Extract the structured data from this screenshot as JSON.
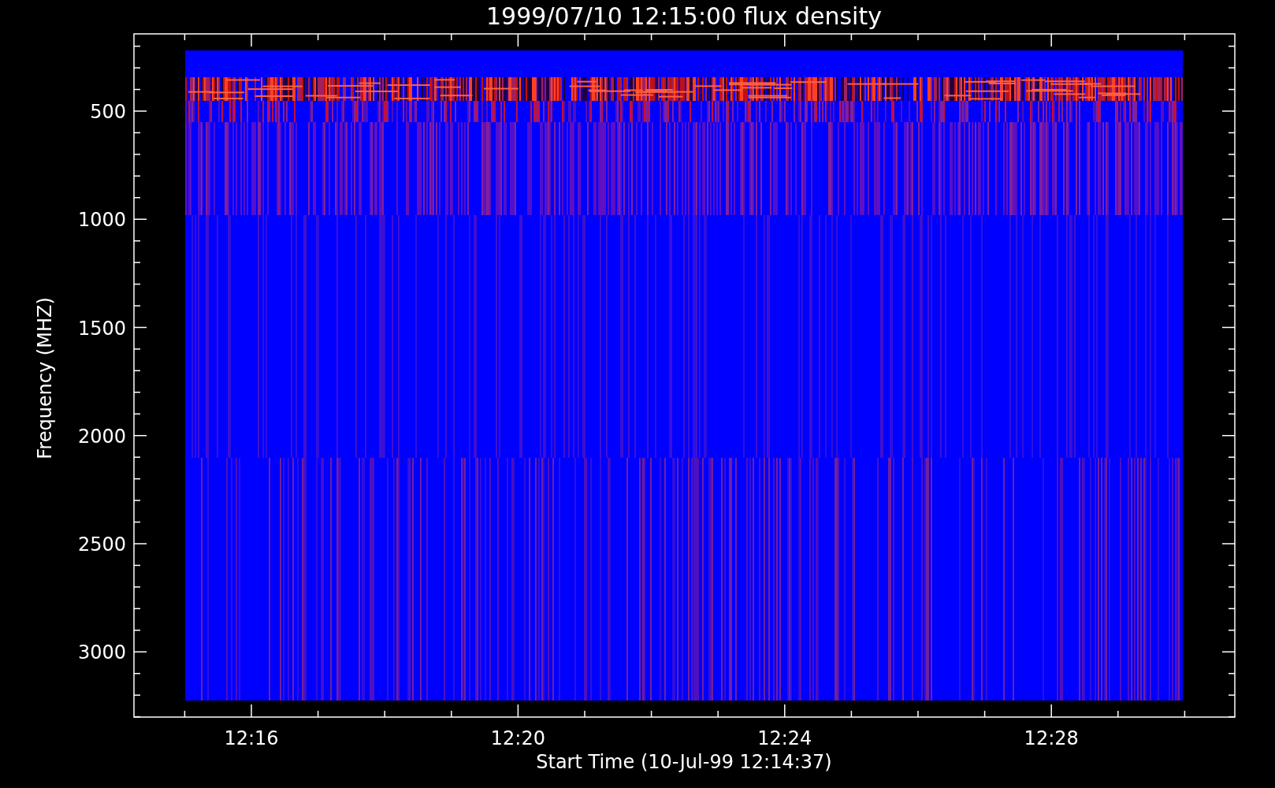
{
  "plot": {
    "title": "1999/07/10 12:15:00 flux density",
    "ylabel": "Frequency (MHZ)",
    "xlabel": "Start Time (10-Jul-99 12:14:37)",
    "yticks": [
      {
        "label": "500"
      },
      {
        "label": "1000"
      },
      {
        "label": "1500"
      },
      {
        "label": "2000"
      },
      {
        "label": "2500"
      },
      {
        "label": "3000"
      }
    ],
    "xticks": [
      {
        "label": "12:16"
      },
      {
        "label": "12:20"
      },
      {
        "label": "12:24"
      },
      {
        "label": "12:28"
      }
    ]
  }
}
